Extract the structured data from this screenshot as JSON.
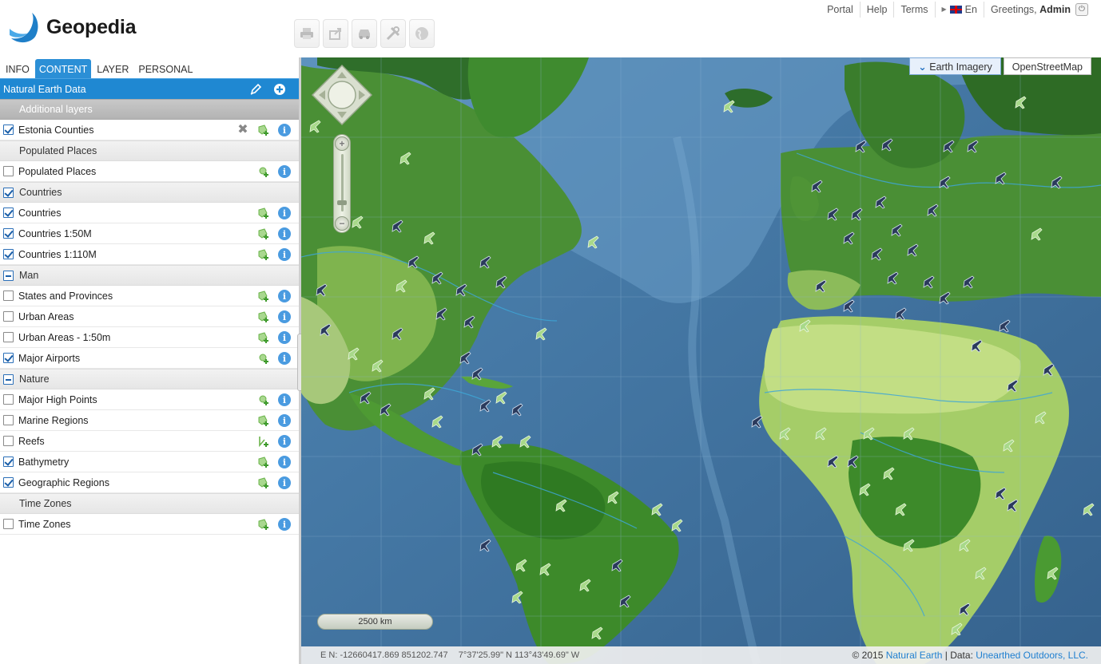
{
  "app": {
    "logo_text": "Geopedia"
  },
  "top_links": {
    "portal": "Portal",
    "help": "Help",
    "terms": "Terms",
    "language": "En",
    "greeting_prefix": "Greetings,",
    "user": "Admin"
  },
  "toolbar": {
    "buttons": [
      "print-icon",
      "share-icon",
      "car-icon",
      "tools-icon",
      "globe-icon"
    ]
  },
  "tabs": [
    {
      "label": "INFO",
      "active": false
    },
    {
      "label": "CONTENT",
      "active": true
    },
    {
      "label": "LAYER",
      "active": false
    },
    {
      "label": "PERSONAL",
      "active": false
    }
  ],
  "theme": {
    "title": "Natural Earth Data"
  },
  "groups": {
    "additional": "Additional layers",
    "populated": "Populated Places",
    "countries": "Countries",
    "man": "Man",
    "nature": "Nature",
    "timezones": "Time Zones"
  },
  "layers": {
    "estonia": "Estonia Counties",
    "populated": "Populated Places",
    "countries": "Countries",
    "countries50": "Countries 1:50M",
    "countries110": "Countries 1:110M",
    "states": "States and Provinces",
    "urban": "Urban Areas",
    "urban50": "Urban Areas - 1:50m",
    "airports": "Major Airports",
    "highpoints": "Major High Points",
    "marine": "Marine Regions",
    "reefs": "Reefs",
    "bathymetry": "Bathymetry",
    "georegions": "Geographic Regions",
    "timezones": "Time Zones"
  },
  "map": {
    "base_layers": {
      "earth": "Earth Imagery",
      "osm": "OpenStreetMap"
    },
    "scale": "2500 km",
    "coords": {
      "en": "E N: -12660417.869 851202.747",
      "latlon": "7°37'25.99\" N 113°43'49.69\" W"
    },
    "attribution": {
      "copyright": "© 2015",
      "natural_earth": "Natural Earth",
      "sep": "| Data:",
      "unearthed": "Unearthed Outdoors, LLC."
    }
  },
  "colors": {
    "accent": "#1f88d2",
    "ocean": "#3d6f9c",
    "land_green": "#3f8a2e",
    "desert": "#a8cc6a",
    "airport_dark": "#2b3a5c",
    "airport_light": "#9ed37a"
  }
}
